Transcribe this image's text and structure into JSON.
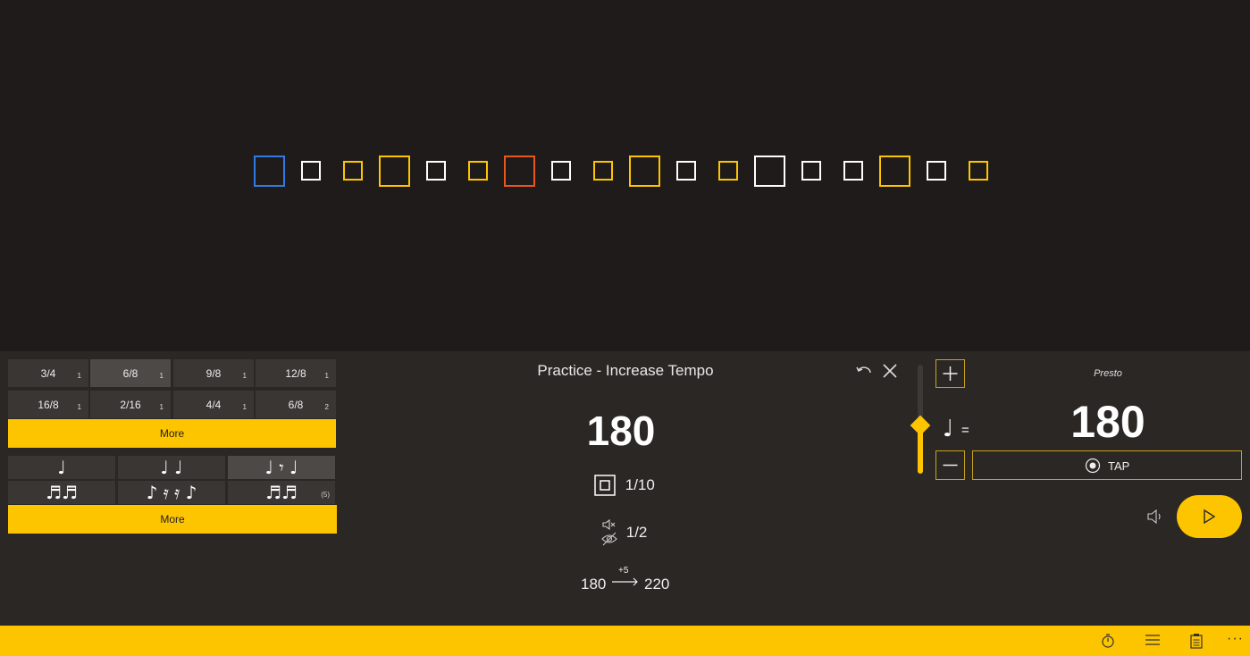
{
  "beats": [
    {
      "size": "large",
      "color": "#2f7ae5"
    },
    {
      "size": "small",
      "color": "#ffffff"
    },
    {
      "size": "small",
      "color": "#fdc500"
    },
    {
      "size": "large",
      "color": "#fdc500"
    },
    {
      "size": "small",
      "color": "#ffffff"
    },
    {
      "size": "small",
      "color": "#fdc500"
    },
    {
      "size": "large",
      "color": "#e8571b"
    },
    {
      "size": "small",
      "color": "#ffffff"
    },
    {
      "size": "small",
      "color": "#fdc500"
    },
    {
      "size": "large",
      "color": "#fdc500"
    },
    {
      "size": "small",
      "color": "#ffffff"
    },
    {
      "size": "small",
      "color": "#fdc500"
    },
    {
      "size": "large",
      "color": "#ffffff"
    },
    {
      "size": "small",
      "color": "#ffffff"
    },
    {
      "size": "small",
      "color": "#ffffff"
    },
    {
      "size": "large",
      "color": "#fdc500"
    },
    {
      "size": "small",
      "color": "#ffffff"
    },
    {
      "size": "small",
      "color": "#fdc500"
    }
  ],
  "time_signatures": [
    {
      "label": "3/4",
      "count": "1",
      "selected": false
    },
    {
      "label": "6/8",
      "count": "1",
      "selected": true
    },
    {
      "label": "9/8",
      "count": "1",
      "selected": false
    },
    {
      "label": "12/8",
      "count": "1",
      "selected": false
    },
    {
      "label": "16/8",
      "count": "1",
      "selected": false
    },
    {
      "label": "2/16",
      "count": "1",
      "selected": false
    },
    {
      "label": "4/4",
      "count": "1",
      "selected": false
    },
    {
      "label": "6/8",
      "count": "2",
      "selected": false
    }
  ],
  "more_time_label": "More",
  "rhythms": [
    {
      "glyph": "♩",
      "count": "",
      "selected": false
    },
    {
      "glyph": "♩ ♩",
      "count": "",
      "selected": false
    },
    {
      "glyph": "♩ 𝄾 ♩",
      "count": "",
      "selected": true
    },
    {
      "glyph": "♬♬",
      "count": "",
      "selected": false
    },
    {
      "glyph": "♪ 𝄿 𝄿 ♪",
      "count": "",
      "selected": false
    },
    {
      "glyph": "♬♬",
      "count": "(5)",
      "selected": false
    }
  ],
  "more_rhythm_label": "More",
  "practice": {
    "title": "Practice - Increase Tempo",
    "undo_icon": "undo-icon",
    "close_icon": "close-icon",
    "tempo": "180",
    "bars": "1/10",
    "mute": "1/2",
    "from": "180",
    "step": "+5",
    "to": "220"
  },
  "right": {
    "tempo_name": "Presto",
    "note_equals": "=",
    "tempo": "180",
    "tap_label": "TAP",
    "plus_icon": "plus-icon",
    "minus_icon": "minus-icon",
    "volume_icon": "volume-icon",
    "play_icon": "play-icon"
  },
  "colors": {
    "accent": "#fdc500",
    "panel": "#2b2725",
    "background": "#1f1b1a"
  }
}
